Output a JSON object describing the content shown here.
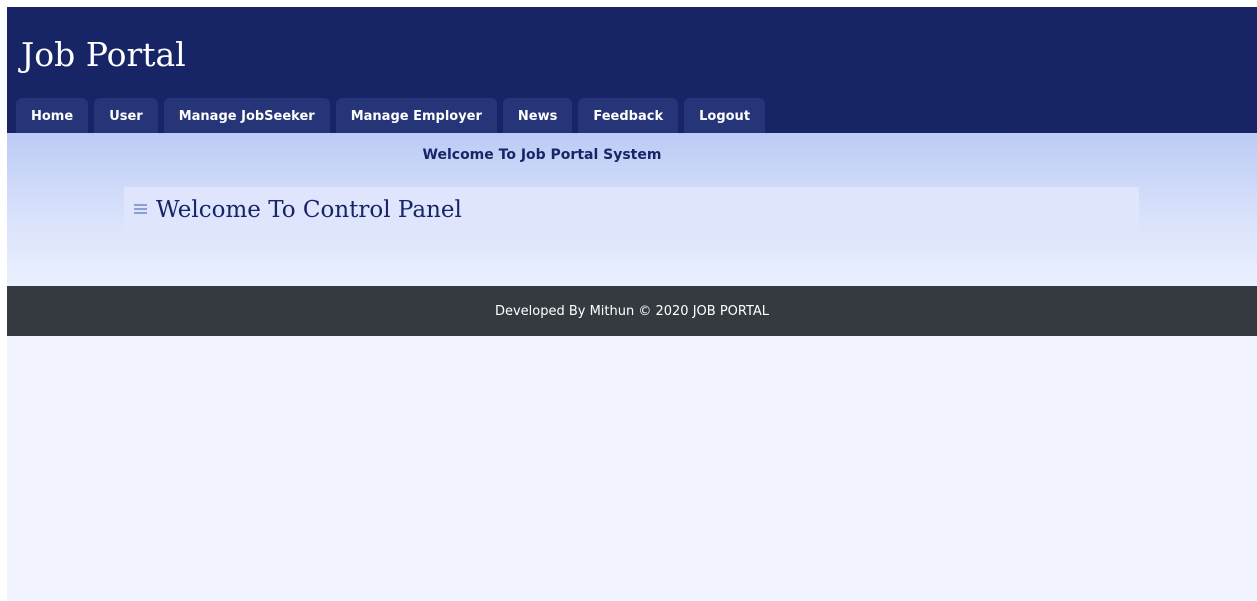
{
  "header": {
    "title": "Job Portal"
  },
  "nav": {
    "items": [
      {
        "label": "Home"
      },
      {
        "label": "User"
      },
      {
        "label": "Manage JobSeeker"
      },
      {
        "label": "Manage Employer"
      },
      {
        "label": "News"
      },
      {
        "label": "Feedback"
      },
      {
        "label": "Logout"
      }
    ]
  },
  "main": {
    "welcome_heading": "Welcome To Job Portal System",
    "panel_icon": "menu-lines-icon",
    "panel_title": "Welcome To Control Panel"
  },
  "footer": {
    "text": "Developed By Mithun © 2020 JOB PORTAL"
  },
  "colors": {
    "header_bg": "#172567",
    "nav_tab_bg": "#253578",
    "content_gradient_top": "#bccbf5",
    "panel_bg": "#dfe5fd",
    "footer_bg": "#353940",
    "page_bg": "#f1f4fe"
  }
}
